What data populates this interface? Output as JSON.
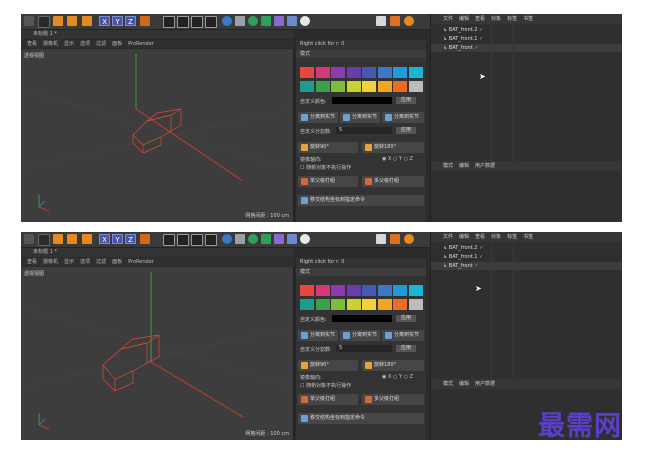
{
  "toolbar": {
    "icon_names": [
      "undo-icon",
      "move-icon",
      "scale-icon",
      "rotate-icon",
      "select-icon",
      "x-axis-icon",
      "y-axis-icon",
      "z-axis-icon",
      "coords-icon",
      "render-icon",
      "render-settings-icon",
      "cube-icon",
      "pen-icon",
      "subdivide-icon",
      "deformer-icon",
      "scene-icon",
      "camera-icon",
      "light-icon",
      "snap-icon",
      "lock-icon",
      "script-icon"
    ],
    "axis_x": "X",
    "axis_y": "Y",
    "axis_z": "Z",
    "right_icons": [
      "save-icon",
      "gear-icon",
      "plugin-icon"
    ]
  },
  "viewport": {
    "tab_title": "未标题 1 *",
    "menu": [
      "查看",
      "摄像机",
      "显示",
      "选项",
      "过滤",
      "面板",
      "ProRender"
    ],
    "label": "透视视图",
    "grid_info": "网格间距 : 100 cm",
    "axis_labels": {
      "y": "y",
      "x": "x",
      "z": "z"
    }
  },
  "attributes": {
    "title": "Right click for r: 0",
    "mode": "模式",
    "palette": [
      "#e8473c",
      "#d6387c",
      "#8d3bb0",
      "#6a3eaa",
      "#4858b0",
      "#3a78c8",
      "#1f9adc",
      "#1bb3d6",
      "#1c9c8c",
      "#3aa04a",
      "#7ebc3e",
      "#c8d232",
      "#f2d23a",
      "#f4a423",
      "#ef6b23",
      "#bbbbbb"
    ],
    "custom_color_label": "自定义颜色:",
    "apply": "应用",
    "pin_buttons": [
      "分离到实节",
      "分离到实节",
      "分离到实节"
    ],
    "custom_split_label": "自定义分割数:",
    "custom_split_value": "5",
    "rotate_90": "旋转90°",
    "rotate_180": "旋转180°",
    "mirror_axis_label": "镜像轴向:",
    "axes": [
      "X",
      "Y",
      "Z"
    ],
    "checkbox_label": "随新对象不执行操作",
    "single_button": "单父级打组",
    "multi_button": "多父级打组",
    "bottom_button": "移交结构坐标到指定命令"
  },
  "objects": {
    "menu": [
      "文件",
      "编辑",
      "查看",
      "对象",
      "标签",
      "书签"
    ],
    "top_names": [
      "BAT_front.2",
      "BAT_front.1",
      "BAT_front"
    ],
    "bottom_names": [
      "BAT_front.2",
      "BAT_front.1",
      "BAT_front"
    ],
    "bottom_menu": [
      "模式",
      "编辑",
      "用户数据"
    ]
  },
  "watermark": "最需网"
}
